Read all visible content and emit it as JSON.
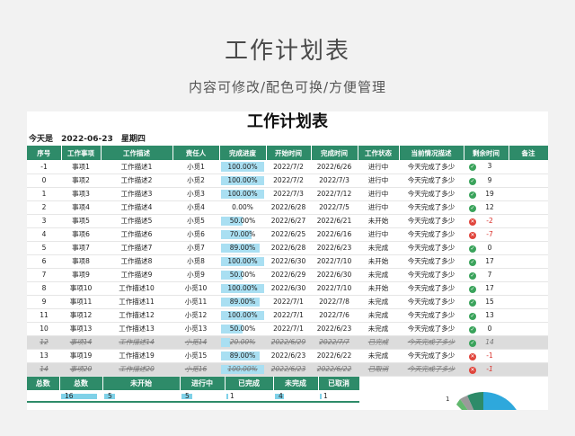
{
  "header": {
    "title": "工作计划表",
    "subtitle": "内容可修改/配色可换/方便管理"
  },
  "sheet": {
    "title": "工作计划表",
    "today_label": "今天是",
    "today_date": "2022-06-23",
    "today_weekday": "星期四"
  },
  "columns": [
    "序号",
    "工作事项",
    "工作描述",
    "责任人",
    "完成进度",
    "开始时间",
    "完成时间",
    "工作状态",
    "当前情况描述",
    "剩余时间",
    "备注"
  ],
  "rows": [
    {
      "no": "-1",
      "item": "事项1",
      "desc": "工作描述1",
      "owner": "小觅1",
      "progress": "100.00%",
      "pct": 1.0,
      "start": "2022/7/2",
      "end": "2022/6/26",
      "status": "进行中",
      "note": "今天完成了多少",
      "icon": "ok",
      "remain": "3",
      "neg": false,
      "striked": false
    },
    {
      "no": "0",
      "item": "事项2",
      "desc": "工作描述2",
      "owner": "小觅2",
      "progress": "100.00%",
      "pct": 1.0,
      "start": "2022/7/2",
      "end": "2022/7/3",
      "status": "进行中",
      "note": "今天完成了多少",
      "icon": "ok",
      "remain": "9",
      "neg": false,
      "striked": false
    },
    {
      "no": "1",
      "item": "事项3",
      "desc": "工作描述3",
      "owner": "小觅3",
      "progress": "100.00%",
      "pct": 1.0,
      "start": "2022/7/3",
      "end": "2022/7/12",
      "status": "进行中",
      "note": "今天完成了多少",
      "icon": "ok",
      "remain": "19",
      "neg": false,
      "striked": false
    },
    {
      "no": "2",
      "item": "事项4",
      "desc": "工作描述4",
      "owner": "小觅4",
      "progress": "0.00%",
      "pct": 0.0,
      "start": "2022/6/28",
      "end": "2022/7/5",
      "status": "进行中",
      "note": "今天完成了多少",
      "icon": "ok",
      "remain": "12",
      "neg": false,
      "striked": false
    },
    {
      "no": "3",
      "item": "事项5",
      "desc": "工作描述5",
      "owner": "小觅5",
      "progress": "50.00%",
      "pct": 0.5,
      "start": "2022/6/27",
      "end": "2022/6/21",
      "status": "未开始",
      "note": "今天完成了多少",
      "icon": "bad",
      "remain": "-2",
      "neg": true,
      "striked": false
    },
    {
      "no": "4",
      "item": "事项6",
      "desc": "工作描述6",
      "owner": "小觅6",
      "progress": "70.00%",
      "pct": 0.7,
      "start": "2022/6/25",
      "end": "2022/6/16",
      "status": "进行中",
      "note": "今天完成了多少",
      "icon": "bad",
      "remain": "-7",
      "neg": true,
      "striked": false
    },
    {
      "no": "5",
      "item": "事项7",
      "desc": "工作描述7",
      "owner": "小觅7",
      "progress": "89.00%",
      "pct": 0.89,
      "start": "2022/6/28",
      "end": "2022/6/23",
      "status": "未完成",
      "note": "今天完成了多少",
      "icon": "ok",
      "remain": "0",
      "neg": false,
      "striked": false
    },
    {
      "no": "6",
      "item": "事项8",
      "desc": "工作描述8",
      "owner": "小觅8",
      "progress": "100.00%",
      "pct": 1.0,
      "start": "2022/6/30",
      "end": "2022/7/10",
      "status": "未开始",
      "note": "今天完成了多少",
      "icon": "ok",
      "remain": "17",
      "neg": false,
      "striked": false
    },
    {
      "no": "7",
      "item": "事项9",
      "desc": "工作描述9",
      "owner": "小觅9",
      "progress": "50.00%",
      "pct": 0.5,
      "start": "2022/6/29",
      "end": "2022/6/30",
      "status": "未完成",
      "note": "今天完成了多少",
      "icon": "ok",
      "remain": "7",
      "neg": false,
      "striked": false
    },
    {
      "no": "8",
      "item": "事项10",
      "desc": "工作描述10",
      "owner": "小觅10",
      "progress": "100.00%",
      "pct": 1.0,
      "start": "2022/6/30",
      "end": "2022/7/10",
      "status": "未开始",
      "note": "今天完成了多少",
      "icon": "ok",
      "remain": "17",
      "neg": false,
      "striked": false
    },
    {
      "no": "9",
      "item": "事项11",
      "desc": "工作描述11",
      "owner": "小觅11",
      "progress": "89.00%",
      "pct": 0.89,
      "start": "2022/7/1",
      "end": "2022/7/8",
      "status": "未完成",
      "note": "今天完成了多少",
      "icon": "ok",
      "remain": "15",
      "neg": false,
      "striked": false
    },
    {
      "no": "11",
      "item": "事项12",
      "desc": "工作描述12",
      "owner": "小觅12",
      "progress": "100.00%",
      "pct": 1.0,
      "start": "2022/7/1",
      "end": "2022/7/6",
      "status": "未完成",
      "note": "今天完成了多少",
      "icon": "ok",
      "remain": "13",
      "neg": false,
      "striked": false
    },
    {
      "no": "10",
      "item": "事项13",
      "desc": "工作描述13",
      "owner": "小觅13",
      "progress": "50.00%",
      "pct": 0.5,
      "start": "2022/7/1",
      "end": "2022/6/23",
      "status": "未完成",
      "note": "今天完成了多少",
      "icon": "ok",
      "remain": "0",
      "neg": false,
      "striked": false
    },
    {
      "no": "12",
      "item": "事项14",
      "desc": "工作描述14",
      "owner": "小觅14",
      "progress": "20.00%",
      "pct": 0.2,
      "start": "2022/6/29",
      "end": "2022/7/7",
      "status": "已完成",
      "note": "今天完成了多少",
      "icon": "ok",
      "remain": "14",
      "neg": false,
      "striked": true
    },
    {
      "no": "13",
      "item": "事项19",
      "desc": "工作描述19",
      "owner": "小觅15",
      "progress": "89.00%",
      "pct": 0.89,
      "start": "2022/6/23",
      "end": "2022/6/22",
      "status": "未完成",
      "note": "今天完成了多少",
      "icon": "bad",
      "remain": "-1",
      "neg": true,
      "striked": false
    },
    {
      "no": "14",
      "item": "事项20",
      "desc": "工作描述20",
      "owner": "小觅16",
      "progress": "100.00%",
      "pct": 1.0,
      "start": "2022/6/23",
      "end": "2022/6/22",
      "status": "已取消",
      "note": "今天完成了多少",
      "icon": "bad",
      "remain": "-1",
      "neg": true,
      "striked": true
    }
  ],
  "summary": {
    "headers": [
      "总数",
      "总数",
      "未开始",
      "进行中",
      "已完成",
      "未完成",
      "已取消"
    ],
    "values": [
      {
        "text": "",
        "pct": 0
      },
      {
        "text": "16",
        "pct": 1.0
      },
      {
        "text": "5",
        "pct": 0.31
      },
      {
        "text": "5",
        "pct": 0.31
      },
      {
        "text": "1",
        "pct": 0.06
      },
      {
        "text": "4",
        "pct": 0.25
      },
      {
        "text": "1",
        "pct": 0.06
      }
    ]
  },
  "chart_data": {
    "type": "pie",
    "slices_label": [
      "1"
    ],
    "colors": [
      "#2ea8dc",
      "#2e8b69",
      "#9a9a9a",
      "#62b86e"
    ]
  },
  "colors": {
    "header_green": "#2e8b69",
    "bar_blue": "#a9dff2",
    "ok_green": "#3aa35b",
    "bad_red": "#e0443b"
  }
}
